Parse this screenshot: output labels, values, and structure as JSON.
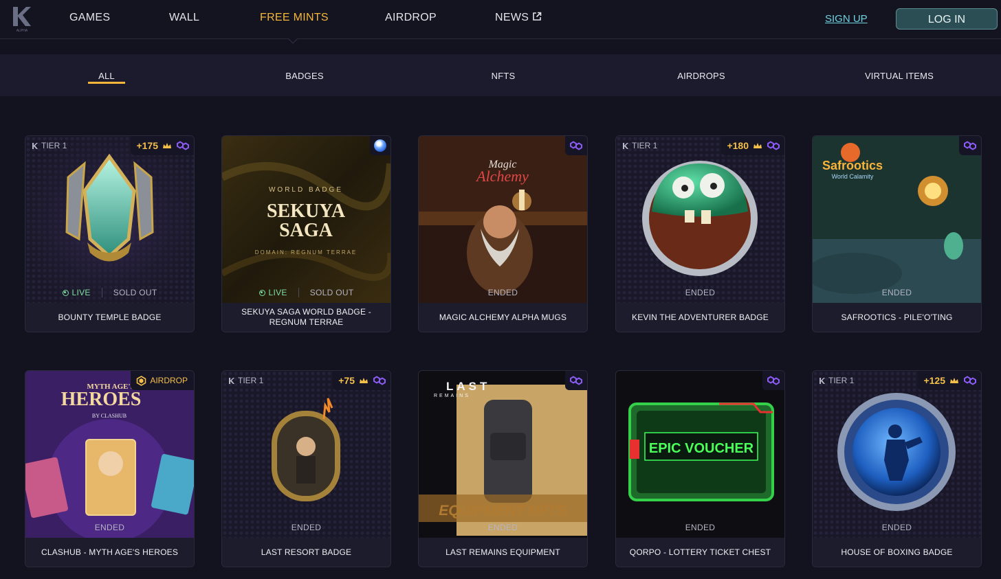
{
  "nav": {
    "logo_text": "ALPHA",
    "links": [
      {
        "label": "GAMES"
      },
      {
        "label": "WALL"
      },
      {
        "label": "FREE MINTS"
      },
      {
        "label": "AIRDROP"
      },
      {
        "label": "NEWS"
      }
    ],
    "active": "FREE MINTS",
    "signup_label": "SIGN UP",
    "login_label": "LOG IN"
  },
  "filters": {
    "tabs": [
      "ALL",
      "BADGES",
      "NFTS",
      "AIRDROPS",
      "VIRTUAL ITEMS"
    ],
    "selected": "ALL"
  },
  "colors": {
    "accent": "#f5b73a",
    "live": "#7ee0a2",
    "signup": "#6fd3e0",
    "login_bg": "#2b4e55"
  },
  "status_labels": {
    "live": "LIVE",
    "sold_out": "SOLD OUT",
    "ended": "ENDED"
  },
  "cards": [
    {
      "name": "BOUNTY TEMPLE BADGE",
      "tier": "TIER 1",
      "points": "+175",
      "status": "LIVE",
      "status2": "SOLD OUT",
      "chain_icon": "polygon-icon",
      "art": {
        "world_text": "",
        "title1": "",
        "title2": "",
        "domain": "",
        "heroes_title": "",
        "by": "",
        "last": "",
        "remains": "",
        "equip": "",
        "voucher": "",
        "airdrop_label": ""
      }
    },
    {
      "name": "SEKUYA SAGA WORLD BADGE - REGNUM TERRAE",
      "tier": "",
      "points": "",
      "status": "LIVE",
      "status2": "SOLD OUT",
      "chain_icon": "blue-orb-icon",
      "art": {
        "world_text": "WORLD BADGE",
        "title1": "SEKUYA",
        "title2": "SAGA",
        "domain": "DOMAIN: REGNUM TERRAE"
      }
    },
    {
      "name": "MAGIC ALCHEMY ALPHA MUGS",
      "tier": "",
      "points": "",
      "status": "ENDED",
      "status2": "",
      "chain_icon": "polygon-icon",
      "art": {
        "title1": "Magic",
        "title2": "Alchemy"
      }
    },
    {
      "name": "KEVIN THE ADVENTURER BADGE",
      "tier": "TIER 1",
      "points": "+180",
      "status": "ENDED",
      "status2": "",
      "chain_icon": "polygon-icon",
      "art": {}
    },
    {
      "name": "SAFROOTICS - PILE'O'TING",
      "tier": "",
      "points": "",
      "status": "ENDED",
      "status2": "",
      "chain_icon": "polygon-icon",
      "art": {
        "title1": "Safrootics",
        "title2": "World Calamity"
      }
    },
    {
      "name": "CLASHUB - MYTH AGE'S HEROES",
      "tier": "",
      "points": "",
      "status": "ENDED",
      "status2": "",
      "chain_icon": "airdrop-icon",
      "art": {
        "airdrop_label": "AIRDROP",
        "title1": "MYTH AGE'S",
        "heroes_title": "HEROES",
        "by": "BY CLASHUB"
      }
    },
    {
      "name": "LAST RESORT BADGE",
      "tier": "TIER 1",
      "points": "+75",
      "status": "ENDED",
      "status2": "",
      "chain_icon": "polygon-icon",
      "art": {}
    },
    {
      "name": "LAST REMAINS EQUIPMENT",
      "tier": "",
      "points": "",
      "status": "ENDED",
      "status2": "",
      "chain_icon": "polygon-icon",
      "art": {
        "last": "LAST",
        "remains": "REMAINS",
        "equip": "EQUIPMENT NFTS"
      }
    },
    {
      "name": "QORPO - LOTTERY TICKET CHEST",
      "tier": "",
      "points": "",
      "status": "ENDED",
      "status2": "",
      "chain_icon": "polygon-icon",
      "art": {
        "voucher": "EPIC VOUCHER"
      }
    },
    {
      "name": "HOUSE OF BOXING BADGE",
      "tier": "TIER 1",
      "points": "+125",
      "status": "ENDED",
      "status2": "",
      "chain_icon": "polygon-icon",
      "art": {}
    }
  ]
}
